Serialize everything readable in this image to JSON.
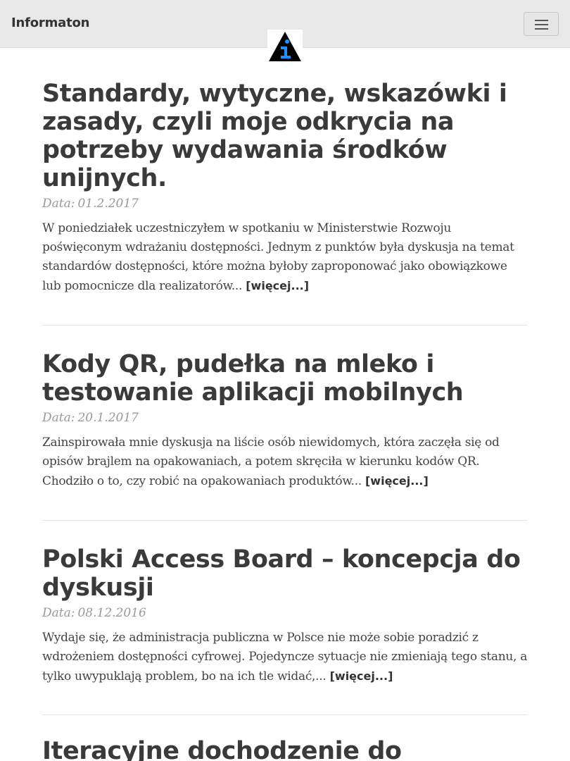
{
  "navbar": {
    "brand": "Informaton",
    "toggle_icon": "hamburger-menu-icon"
  },
  "logo": {
    "icon": "information-triangle-logo",
    "colors": {
      "background": "#000000",
      "letter": "#1e90ff"
    }
  },
  "posts": [
    {
      "title": "Standardy, wytyczne, wskazówki i zasady, czyli moje odkrycia na potrzeby wydawania środków unijnych.",
      "date_label": "Data:",
      "date": "01.2.2017",
      "excerpt": "W poniedziałek uczestniczyłem w spotkaniu w Ministerstwie Rozwoju poświęconym wdrażaniu dostępności. Jednym z punktów była dyskusja na temat standardów dostępności, które można byłoby zaproponować jako obowiązkowe lub pomocnicze dla realizatorów...",
      "more": "[więcej...]"
    },
    {
      "title": "Kody QR, pudełka na mleko i testowanie aplikacji mobilnych",
      "date_label": "Data:",
      "date": "20.1.2017",
      "excerpt": "Zainspirowała mnie dyskusja na liście osób niewidomych, która zaczęła się od opisów brajlem na opakowaniach, a potem skręciła w kierunku kodów QR. Chodziło o to, czy robić na opakowaniach produktów...",
      "more": "[więcej...]"
    },
    {
      "title": "Polski Access Board – koncepcja do dyskusji",
      "date_label": "Data:",
      "date": "08.12.2016",
      "excerpt": "Wydaje się, że administracja publiczna w Polsce nie może sobie poradzić z wdrożeniem dostępności cyfrowej. Pojedyncze sytuacje nie zmieniają tego stanu, a tylko uwypuklają problem, bo na ich tle widać,...",
      "more": "[więcej...]"
    },
    {
      "title": "Iteracyjne dochodzenie do"
    }
  ]
}
